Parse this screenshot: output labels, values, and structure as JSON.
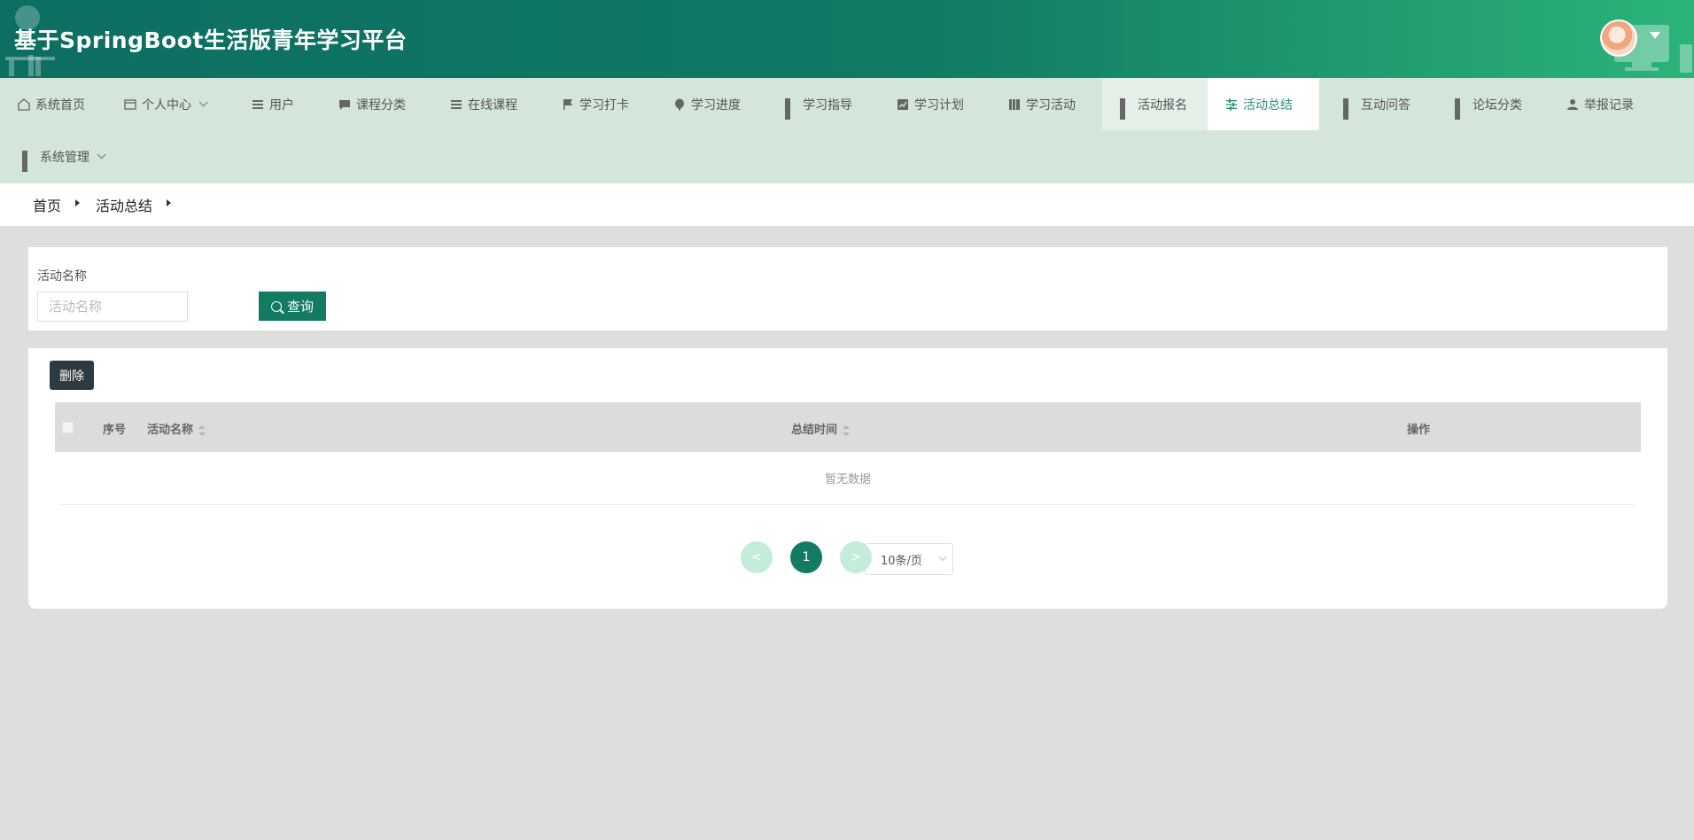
{
  "header": {
    "title": "基于SpringBoot生活版青年学习平台",
    "avatar_icon": "user-avatar",
    "colors": {
      "primary": "#137a63",
      "header_start": "#0d6e62",
      "header_end": "#2bb478",
      "nav_bg": "#d3e6d9"
    }
  },
  "nav": {
    "items": [
      {
        "label": "系统首页",
        "icon": "home-icon"
      },
      {
        "label": "个人中心",
        "icon": "card-icon",
        "has_dropdown": true
      },
      {
        "label": "用户",
        "icon": "list-icon"
      },
      {
        "label": "课程分类",
        "icon": "chat-icon"
      },
      {
        "label": "在线课程",
        "icon": "list-icon"
      },
      {
        "label": "学习打卡",
        "icon": "flag-icon"
      },
      {
        "label": "学习进度",
        "icon": "balloon-icon"
      },
      {
        "label": "学习指导",
        "icon": "grid-icon"
      },
      {
        "label": "学习计划",
        "icon": "chart-icon"
      },
      {
        "label": "学习活动",
        "icon": "book-icon"
      },
      {
        "label": "活动报名",
        "icon": "grid-icon"
      },
      {
        "label": "活动总结",
        "icon": "sliders-icon",
        "active": true
      },
      {
        "label": "互动问答",
        "icon": "grid-icon"
      },
      {
        "label": "论坛分类",
        "icon": "grid-icon"
      },
      {
        "label": "举报记录",
        "icon": "person-icon"
      },
      {
        "label": "系统管理",
        "icon": "grid-icon",
        "has_dropdown": true
      }
    ]
  },
  "breadcrumb": {
    "home": "首页",
    "current": "活动总结"
  },
  "search": {
    "label": "活动名称",
    "placeholder": "活动名称",
    "value": "",
    "button_label": "查询"
  },
  "table": {
    "delete_label": "删除",
    "columns": {
      "index": "序号",
      "name": "活动名称",
      "time": "总结时间",
      "actions": "操作"
    },
    "empty_text": "暂无数据"
  },
  "pagination": {
    "prev": "<",
    "current": "1",
    "next": ">",
    "page_size": "10条/页"
  }
}
